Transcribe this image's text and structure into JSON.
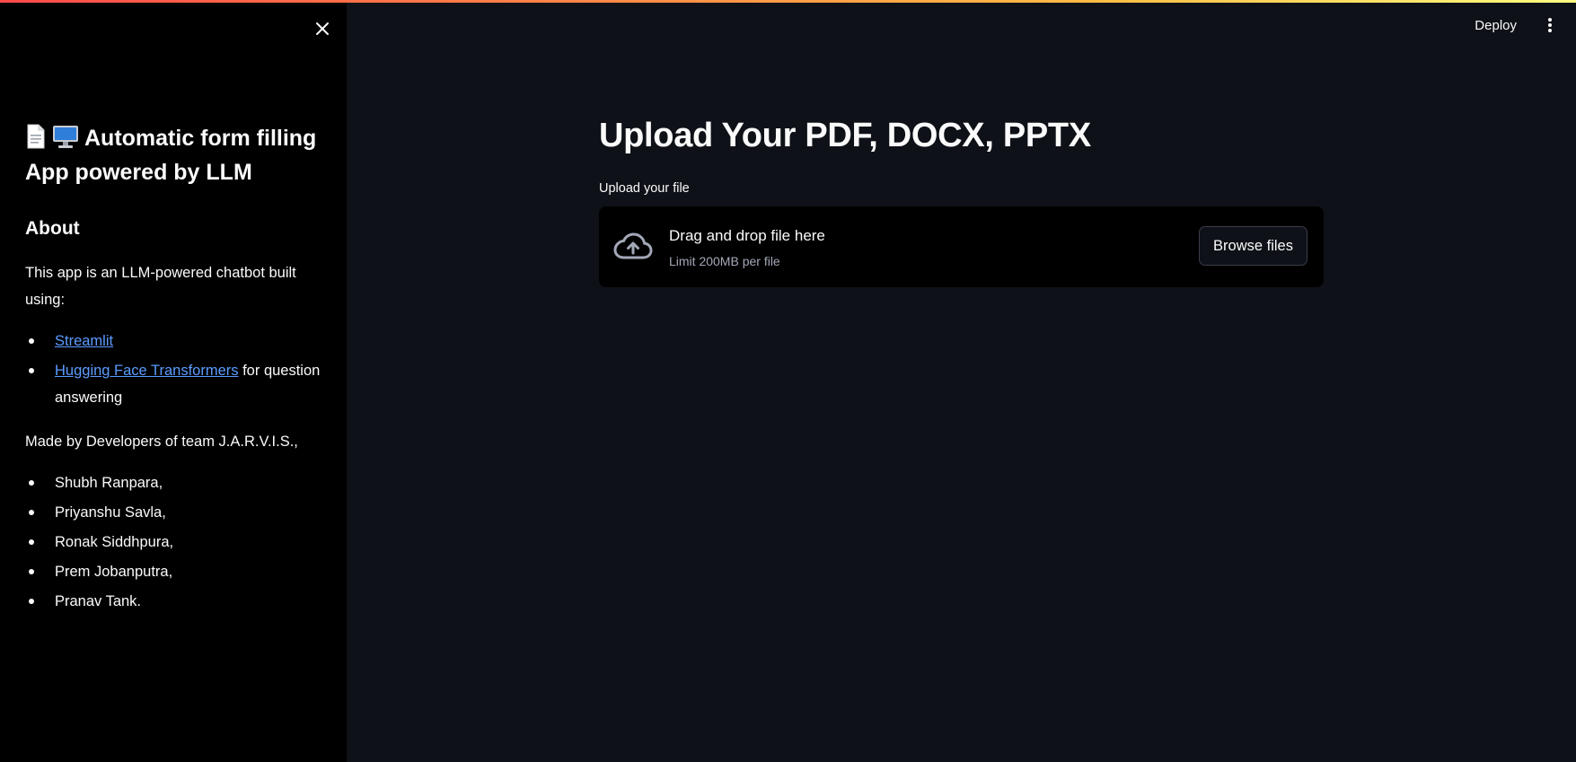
{
  "sidebar": {
    "title": "Automatic form filling App powered by LLM",
    "title_icons": [
      "page-icon",
      "desktop-computer-icon"
    ],
    "about_heading": "About",
    "description": "This app is an LLM-powered chatbot built using:",
    "links": [
      {
        "label": "Streamlit",
        "suffix": ""
      },
      {
        "label": "Hugging Face Transformers",
        "suffix": " for question answering"
      }
    ],
    "made_by": "Made by Developers of team J.A.R.V.I.S.,",
    "developers": [
      "Shubh Ranpara,",
      "Priyanshu Savla,",
      "Ronak Siddhpura,",
      "Prem Jobanputra,",
      "Pranav Tank."
    ]
  },
  "header": {
    "deploy_label": "Deploy"
  },
  "main": {
    "title": "Upload Your PDF, DOCX, PPTX",
    "uploader": {
      "label": "Upload your file",
      "drag_text": "Drag and drop file here",
      "limit_text": "Limit 200MB per file",
      "browse_label": "Browse files"
    }
  },
  "colors": {
    "background": "#0e1117",
    "sidebar": "#000000",
    "link": "#5b9cff",
    "accent_gradient_start": "#ff4b4b",
    "accent_gradient_end": "#fffd80"
  }
}
